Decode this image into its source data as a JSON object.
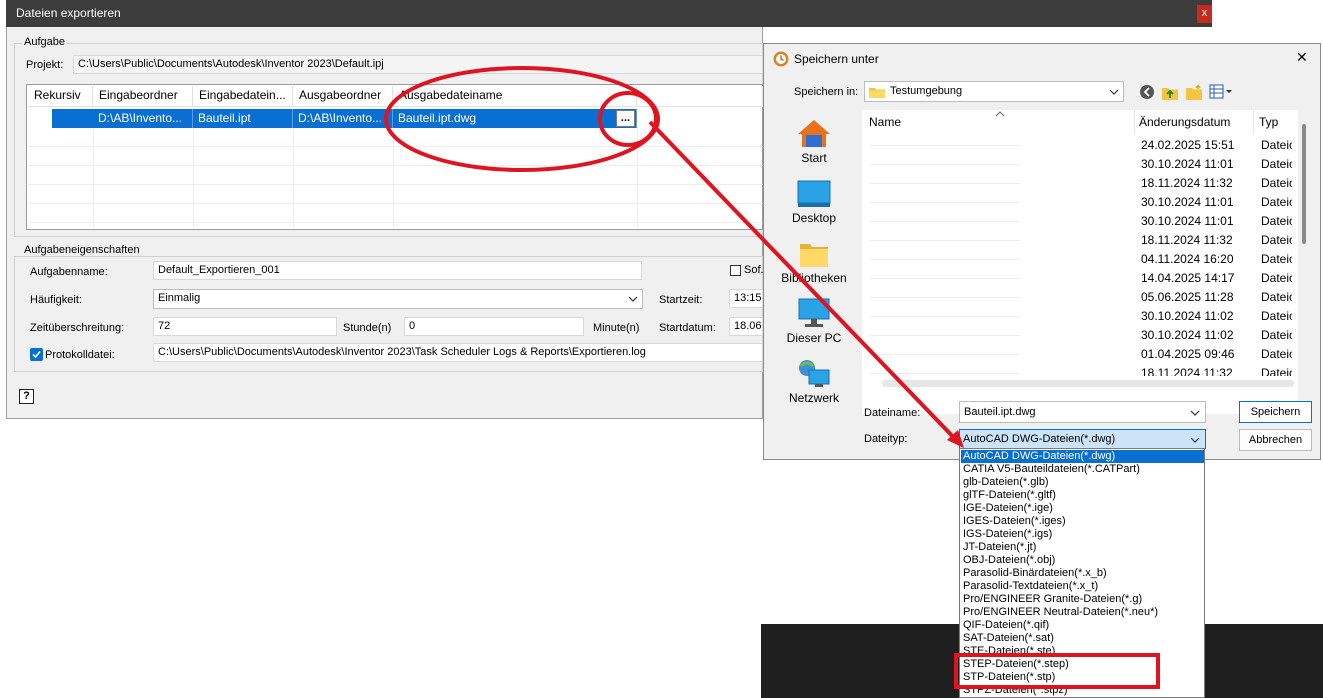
{
  "main": {
    "title": "Dateien exportieren",
    "close": "x",
    "task_group": "Aufgabe",
    "project_label": "Projekt:",
    "project_value": "C:\\Users\\Public\\Documents\\Autodesk\\Inventor 2023\\Default.ipj",
    "grid": {
      "headers": [
        "Rekursiv",
        "Eingabeordner",
        "Eingabedatein...",
        "Ausgabeordner",
        "Ausgabedateiname"
      ],
      "row": [
        "",
        "D:\\AB\\Invento...",
        "Bauteil.ipt",
        "D:\\AB\\Invento...",
        "Bauteil.ipt.dwg"
      ],
      "browse": "..."
    },
    "props_group": "Aufgabeneigenschaften",
    "task_name_label": "Aufgabenname:",
    "task_name_value": "Default_Exportieren_001",
    "sofort": "Sof...",
    "frequency_label": "Häufigkeit:",
    "frequency_value": "Einmalig",
    "start_time_label": "Startzeit:",
    "start_time_value": "13:15",
    "timeout_label": "Zeitüberschreitung:",
    "timeout_hours": "72",
    "hours_unit": "Stunde(n)",
    "timeout_minutes": "0",
    "minutes_unit": "Minute(n)",
    "start_date_label": "Startdatum:",
    "start_date_value": "18.06.",
    "log_label": "Protokolldatei:",
    "log_value": "C:\\Users\\Public\\Documents\\Autodesk\\Inventor 2023\\Task Scheduler Logs & Reports\\Exportieren.log",
    "help": "?"
  },
  "save": {
    "title": "Speichern unter",
    "close": "✕",
    "save_in_label": "Speichern in:",
    "save_in_value": "Testumgebung",
    "sidebar": [
      "Start",
      "Desktop",
      "Bibliotheken",
      "Dieser PC",
      "Netzwerk"
    ],
    "columns": {
      "name": "Name",
      "date": "Änderungsdatum",
      "type": "Typ"
    },
    "rows": [
      {
        "date": "24.02.2025 15:51",
        "type": "Dateio"
      },
      {
        "date": "30.10.2024 11:01",
        "type": "Dateio"
      },
      {
        "date": "18.11.2024 11:32",
        "type": "Dateio"
      },
      {
        "date": "30.10.2024 11:01",
        "type": "Dateio"
      },
      {
        "date": "30.10.2024 11:01",
        "type": "Dateio"
      },
      {
        "date": "18.11.2024 11:32",
        "type": "Dateio"
      },
      {
        "date": "04.11.2024 16:20",
        "type": "Dateio"
      },
      {
        "date": "14.04.2025 14:17",
        "type": "Dateio"
      },
      {
        "date": "05.06.2025 11:28",
        "type": "Dateio"
      },
      {
        "date": "30.10.2024 11:02",
        "type": "Dateio"
      },
      {
        "date": "30.10.2024 11:02",
        "type": "Dateio"
      },
      {
        "date": "01.04.2025 09:46",
        "type": "Dateio"
      },
      {
        "date": "18.11.2024 11:32",
        "type": "Dateio"
      }
    ],
    "filename_label": "Dateiname:",
    "filename_value": "Bauteil.ipt.dwg",
    "filetype_label": "Dateityp:",
    "filetype_value": "AutoCAD DWG-Dateien(*.dwg)",
    "save_button": "Speichern",
    "cancel_button": "Abbrechen",
    "filetype_options": [
      "AutoCAD DWG-Dateien(*.dwg)",
      "CATIA V5-Bauteildateien(*.CATPart)",
      "glb-Dateien(*.glb)",
      "glTF-Dateien(*.gltf)",
      "IGE-Dateien(*.ige)",
      "IGES-Dateien(*.iges)",
      "IGS-Dateien(*.igs)",
      "JT-Dateien(*.jt)",
      "OBJ-Dateien(*.obj)",
      "Parasolid-Binärdateien(*.x_b)",
      "Parasolid-Textdateien(*.x_t)",
      "Pro/ENGINEER Granite-Dateien(*.g)",
      "Pro/ENGINEER Neutral-Dateien(*.neu*)",
      "QIF-Dateien(*.qif)",
      "SAT-Dateien(*.sat)",
      "STE-Dateien(*.ste)",
      "STEP-Dateien(*.step)",
      "STP-Dateien(*.stp)",
      "STPZ-Dateien(*.stpz)"
    ]
  },
  "colors": {
    "selection": "#0a6fd3",
    "annotation": "#e0141e",
    "titlebar": "#3c3c3c"
  }
}
